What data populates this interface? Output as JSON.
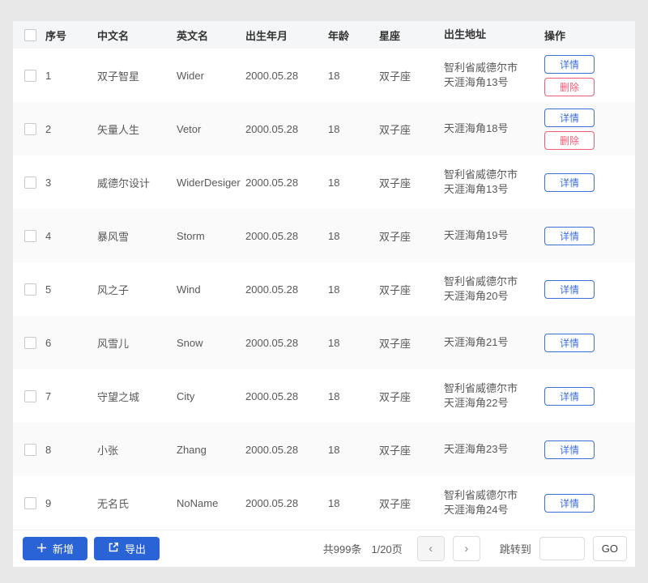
{
  "colors": {
    "accent_blue": "#2a63d6",
    "outline_blue": "#3d6fdb",
    "danger_red": "#ef5e76",
    "header_bg": "#f5f6f7",
    "alt_row_bg": "#fafafa",
    "page_bg": "#e8e8e8"
  },
  "table": {
    "headers": {
      "index": "序号",
      "cn": "中文名",
      "en": "英文名",
      "birth": "出生年月",
      "age": "年龄",
      "zodiac": "星座",
      "address": "出生地址",
      "actions": "操作"
    },
    "action_labels": {
      "detail": "详情",
      "delete": "删除"
    },
    "rows": [
      {
        "index": "1",
        "cn": "双子智星",
        "en": "Wider",
        "birth": "2000.05.28",
        "age": "18",
        "zodiac": "双子座",
        "address1": "智利省威德尔市",
        "address2": "天涯海角13号"
      },
      {
        "index": "2",
        "cn": "矢量人生",
        "en": "Vetor",
        "birth": "2000.05.28",
        "age": "18",
        "zodiac": "双子座",
        "address1": "天涯海角18号"
      },
      {
        "index": "3",
        "cn": "威德尔设计",
        "en": "WiderDesiger",
        "birth": "2000.05.28",
        "age": "18",
        "zodiac": "双子座",
        "address1": "智利省威德尔市",
        "address2": "天涯海角13号"
      },
      {
        "index": "4",
        "cn": "暴风雪",
        "en": "Storm",
        "birth": "2000.05.28",
        "age": "18",
        "zodiac": "双子座",
        "address1": "天涯海角19号"
      },
      {
        "index": "5",
        "cn": "风之子",
        "en": "Wind",
        "birth": "2000.05.28",
        "age": "18",
        "zodiac": "双子座",
        "address1": "智利省威德尔市",
        "address2": "天涯海角20号"
      },
      {
        "index": "6",
        "cn": "风雪儿",
        "en": "Snow",
        "birth": "2000.05.28",
        "age": "18",
        "zodiac": "双子座",
        "address1": "天涯海角21号"
      },
      {
        "index": "7",
        "cn": "守望之城",
        "en": "City",
        "birth": "2000.05.28",
        "age": "18",
        "zodiac": "双子座",
        "address1": "智利省威德尔市",
        "address2": "天涯海角22号"
      },
      {
        "index": "8",
        "cn": "小张",
        "en": "Zhang",
        "birth": "2000.05.28",
        "age": "18",
        "zodiac": "双子座",
        "address1": "天涯海角23号"
      },
      {
        "index": "9",
        "cn": "无名氏",
        "en": "NoName",
        "birth": "2000.05.28",
        "age": "18",
        "zodiac": "双子座",
        "address1": "智利省威德尔市",
        "address2": "天涯海角24号"
      }
    ]
  },
  "footer": {
    "add": "新增",
    "export": "导出",
    "total": "共999条",
    "page": "1/20页",
    "prev_icon": "‹",
    "next_icon": "›",
    "jump": "跳转到",
    "go": "GO"
  }
}
